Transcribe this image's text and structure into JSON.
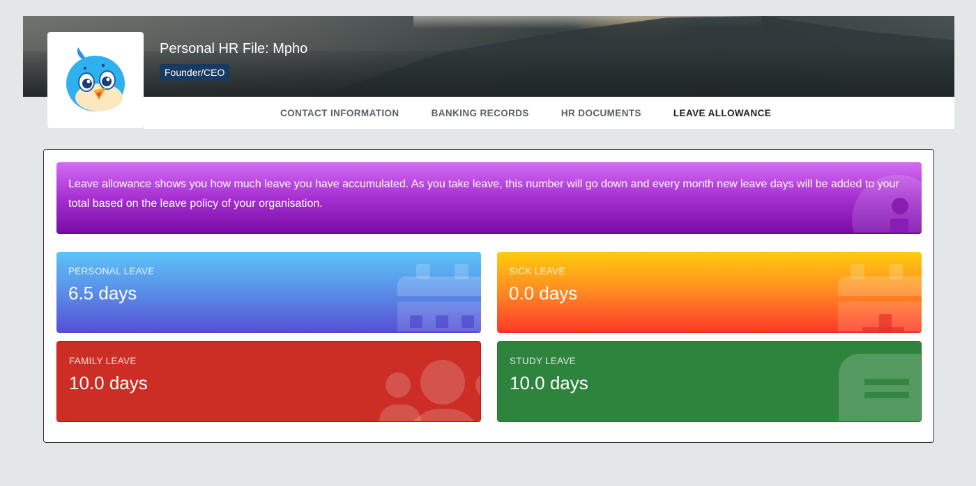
{
  "header": {
    "title": "Personal HR File: Mpho",
    "role_badge": "Founder/CEO",
    "avatar": "bird-mascot-avatar"
  },
  "tabs": [
    {
      "label": "CONTACT INFORMATION",
      "active": false
    },
    {
      "label": "BANKING RECORDS",
      "active": false
    },
    {
      "label": "HR DOCUMENTS",
      "active": false
    },
    {
      "label": "LEAVE ALLOWANCE",
      "active": true
    }
  ],
  "info": {
    "text": "Leave allowance shows you how much leave you have accumulated. As you take leave, this number will go down and every month new leave days will be added to your total based on the leave policy of your organisation.",
    "icon": "info-icon"
  },
  "leave": [
    {
      "label": "PERSONAL LEAVE",
      "value": "6.5 days",
      "icon": "calendar-icon",
      "color": "#5a8ee8"
    },
    {
      "label": "SICK LEAVE",
      "value": "0.0 days",
      "icon": "calendar-plus-icon",
      "color": "#ff8a22"
    },
    {
      "label": "FAMILY LEAVE",
      "value": "10.0 days",
      "icon": "people-icon",
      "color": "#cc2e26"
    },
    {
      "label": "STUDY LEAVE",
      "value": "10.0 days",
      "icon": "document-icon",
      "color": "#2e833d"
    }
  ]
}
